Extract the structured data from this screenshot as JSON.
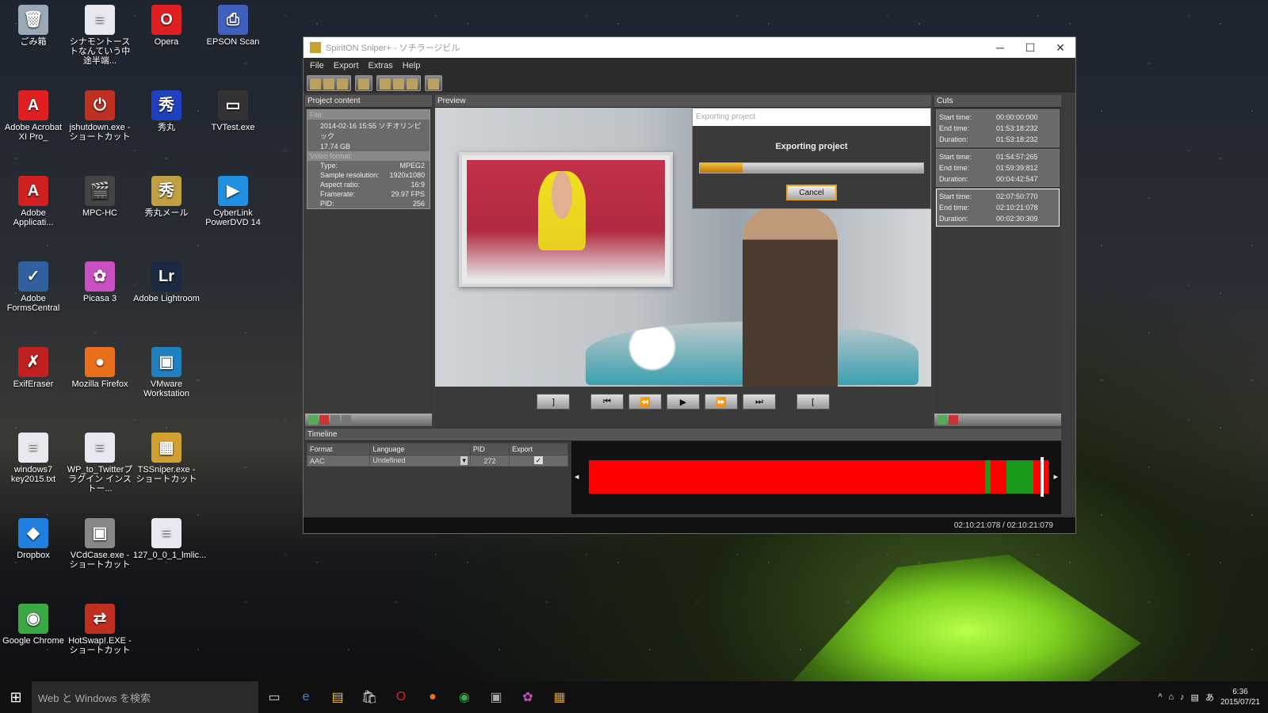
{
  "desktop_icons": [
    {
      "label": "ごみ箱",
      "icon": "recycle-bin-icon",
      "color": "#9aa8b8",
      "glyph": "🗑"
    },
    {
      "label": "シナモントーストなんていう中途半端...",
      "icon": "text-file-icon",
      "color": "#e8e8f0",
      "glyph": "≡"
    },
    {
      "label": "Opera",
      "icon": "opera-icon",
      "color": "#e02020",
      "glyph": "O"
    },
    {
      "label": "EPSON Scan",
      "icon": "scanner-icon",
      "color": "#4060c0",
      "glyph": "⎙"
    },
    {
      "label": "Adobe Acrobat XI Pro_",
      "icon": "acrobat-icon",
      "color": "#e02020",
      "glyph": "A"
    },
    {
      "label": "jshutdown.exe - ショートカット",
      "icon": "shutdown-icon",
      "color": "#c03020",
      "glyph": "⏻"
    },
    {
      "label": "秀丸",
      "icon": "hidemaru-icon",
      "color": "#2040c0",
      "glyph": "秀"
    },
    {
      "label": "TVTest.exe",
      "icon": "tv-icon",
      "color": "#333",
      "glyph": "▭"
    },
    {
      "label": "Adobe Applicati...",
      "icon": "adobe-icon",
      "color": "#d02020",
      "glyph": "A"
    },
    {
      "label": "MPC-HC",
      "icon": "mpc-icon",
      "color": "#444",
      "glyph": "🎬"
    },
    {
      "label": "秀丸メール",
      "icon": "hidemaru-mail-icon",
      "color": "#c0a040",
      "glyph": "秀"
    },
    {
      "label": "CyberLink PowerDVD 14",
      "icon": "powerdvd-icon",
      "color": "#2090e0",
      "glyph": "▶"
    },
    {
      "label": "Adobe FormsCentral",
      "icon": "formscentral-icon",
      "color": "#3060a0",
      "glyph": "✓"
    },
    {
      "label": "Picasa 3",
      "icon": "picasa-icon",
      "color": "#c850c0",
      "glyph": "✿"
    },
    {
      "label": "Adobe Lightroom",
      "icon": "lightroom-icon",
      "color": "#1a2a40",
      "glyph": "Lr"
    },
    {
      "label": "ExifEraser",
      "icon": "exif-eraser-icon",
      "color": "#c02020",
      "glyph": "✗"
    },
    {
      "label": "Mozilla Firefox",
      "icon": "firefox-icon",
      "color": "#e8701a",
      "glyph": "●"
    },
    {
      "label": "VMware Workstation",
      "icon": "vmware-icon",
      "color": "#2080c0",
      "glyph": "▣"
    },
    {
      "label": "windows7 key2015.txt",
      "icon": "text-file-icon",
      "color": "#e8e8f0",
      "glyph": "≡"
    },
    {
      "label": "WP_to_Twitterプラグイン インストー...",
      "icon": "text-file-icon",
      "color": "#e8e8f0",
      "glyph": "≡"
    },
    {
      "label": "TSSniper.exe - ショートカット",
      "icon": "tssniper-icon",
      "color": "#d0a030",
      "glyph": "▦"
    },
    {
      "label": "Dropbox",
      "icon": "dropbox-icon",
      "color": "#2080e0",
      "glyph": "◆"
    },
    {
      "label": "VCdCase.exe - ショートカット",
      "icon": "vcdcase-icon",
      "color": "#888",
      "glyph": "▣"
    },
    {
      "label": "Google Chrome",
      "icon": "chrome-icon",
      "color": "#3aa843",
      "glyph": "◉"
    },
    {
      "label": "HotSwap!.EXE - ショートカット",
      "icon": "hotswap-icon",
      "color": "#c03020",
      "glyph": "⇄"
    },
    {
      "label": "127_0_0_1_lmlic...",
      "icon": "text-file-icon",
      "color": "#e8e8f0",
      "glyph": "≡"
    }
  ],
  "window": {
    "title": "SpiritON Sniper+ - ソチラージビル"
  },
  "menu": [
    "File",
    "Export",
    "Extras",
    "Help"
  ],
  "project": {
    "header": "Project content",
    "file_label": "File:",
    "file_name": "2014-02-16 15:55 ソチオリンピック",
    "file_size": "17.74 GB",
    "video_label": "Video format:",
    "video_format": [
      {
        "k": "Type:",
        "v": "MPEG2"
      },
      {
        "k": "Sample resolution:",
        "v": "1920x1080"
      },
      {
        "k": "Aspect ratio:",
        "v": "16:9"
      },
      {
        "k": "Framerate:",
        "v": "29.97 FPS"
      },
      {
        "k": "PID:",
        "v": "256"
      }
    ]
  },
  "preview": {
    "header": "Preview"
  },
  "dialog": {
    "title": "Exporting project",
    "heading": "Exporting project",
    "progress": 0.19,
    "cancel_label": "Cancel",
    "progress_color": "#e8a020"
  },
  "transport": [
    "]",
    "⏮",
    "⏪",
    "▶",
    "⏩",
    "⏭",
    "["
  ],
  "cuts": {
    "header": "Cuts",
    "items": [
      {
        "start": "00:00:00:000",
        "end": "01:53:18:232",
        "duration": "01:53:18:232"
      },
      {
        "start": "01:54:57:265",
        "end": "01:59:39:812",
        "duration": "00:04:42:547"
      },
      {
        "start": "02:07:50:770",
        "end": "02:10:21:078",
        "duration": "00:02:30:309",
        "selected": true
      }
    ],
    "labels": {
      "start": "Start time:",
      "end": "End time:",
      "duration": "Duration:"
    }
  },
  "timeline": {
    "header": "Timeline",
    "columns": [
      "Format",
      "Language",
      "PID",
      "Export"
    ],
    "row": {
      "format": "AAC",
      "language": "Undefined",
      "pid": "272",
      "export": true
    },
    "segments": [
      {
        "color": "#ff0000",
        "frac": 0.862
      },
      {
        "color": "#1a9a1a",
        "frac": 0.012
      },
      {
        "color": "#ff0000",
        "frac": 0.034
      },
      {
        "color": "#1a9a1a",
        "frac": 0.06
      },
      {
        "color": "#ff0000",
        "frac": 0.032
      }
    ]
  },
  "status": {
    "timecode": "02:10:21:078 / 02:10:21:079"
  },
  "taskbar": {
    "search_placeholder": "Web と Windows を検索",
    "ime": "あ",
    "time": "6:36",
    "date": "2015/07/21"
  }
}
